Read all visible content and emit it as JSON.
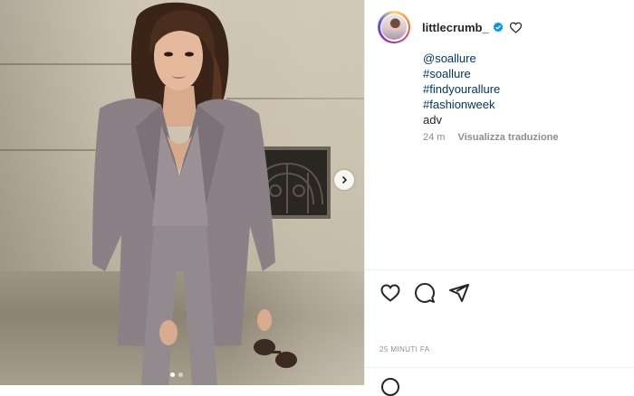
{
  "post": {
    "username": "littlecrumb_",
    "caption": {
      "tags": [
        "@soallure",
        "#soallure",
        "#findyourallure",
        "#fashionweek"
      ],
      "trailing_text": "adv"
    },
    "comment_meta": {
      "age": "24 m",
      "translate_label": "Visualizza traduzione"
    },
    "posted_ago": "25 MINUTI FA",
    "carousel": {
      "current_slide": 1,
      "total_slides": 2
    }
  },
  "icons": {
    "verified": "verified-badge-icon",
    "like_small": "heart-outline-icon",
    "like": "heart-outline-icon",
    "comment": "speech-bubble-icon",
    "share": "paper-plane-icon",
    "next": "chevron-right-icon",
    "emoji": "smiley-icon"
  },
  "colors": {
    "link": "#00376b",
    "verified": "#0095f6",
    "text": "#262626",
    "muted": "#8e8e8e"
  }
}
